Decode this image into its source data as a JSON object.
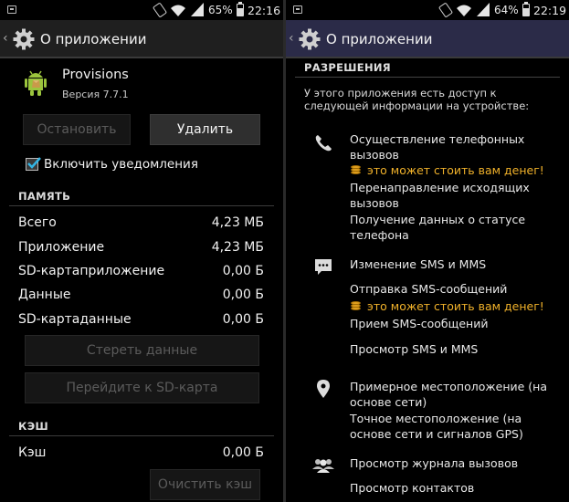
{
  "left": {
    "status": {
      "battery": "65%",
      "battery_level": 0.65,
      "time": "22:16"
    },
    "title": "О приложении",
    "app": {
      "name": "Provisions",
      "version": "Версия 7.7.1"
    },
    "buttons": {
      "stop": "Остановить",
      "delete": "Удалить"
    },
    "notifications_label": "Включить уведомления",
    "notifications_checked": true,
    "memory": {
      "header": "ПАМЯТЬ",
      "rows": [
        {
          "label": "Всего",
          "value": "4,23 МБ"
        },
        {
          "label": "Приложение",
          "value": "4,23 МБ"
        },
        {
          "label": "SD-картаприложение",
          "value": "0,00 Б"
        },
        {
          "label": "Данные",
          "value": "0,00 Б"
        },
        {
          "label": "SD-картаданные",
          "value": "0,00 Б"
        }
      ],
      "clear_data": "Стереть данные",
      "move_to_sd": "Перейдите к SD-карта"
    },
    "cache": {
      "header": "КЭШ",
      "label": "Кэш",
      "value": "0,00 Б",
      "clear_cache": "Очистить кэш"
    }
  },
  "right": {
    "status": {
      "battery": "64%",
      "battery_level": 0.64,
      "time": "22:19"
    },
    "title": "О приложении",
    "permissions_header": "РАЗРЕШЕНИЯ",
    "intro": "У этого приложения есть доступ к следующей информации на устройстве:",
    "groups": {
      "phone": {
        "icon": "phone-icon",
        "call": "Осуществление телефонных вызовов",
        "cost": "это может стоить вам денег!",
        "redirect": "Перенаправление исходящих вызовов",
        "status": "Получение данных о статусе телефона"
      },
      "sms": {
        "icon": "message-icon",
        "edit": "Изменение SMS и MMS",
        "send": "Отправка SMS-сообщений",
        "cost": "это может стоить вам денег!",
        "receive": "Прием SMS-сообщений",
        "view": "Просмотр SMS и MMS"
      },
      "location": {
        "icon": "location-pin-icon",
        "approx": "Примерное местоположение (на основе сети)",
        "precise": "Точное местоположение (на основе сети и сигналов GPS)"
      },
      "contacts": {
        "icon": "people-icon",
        "call_log": "Просмотр журнала вызовов",
        "contacts": "Просмотр контактов"
      }
    }
  }
}
